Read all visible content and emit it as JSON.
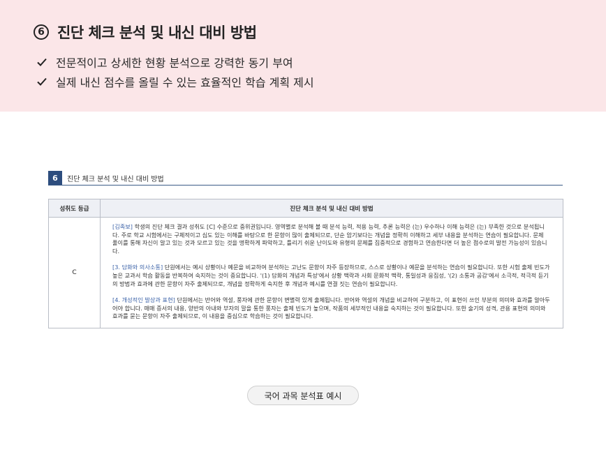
{
  "header": {
    "number": "6",
    "title": "진단 체크 분석 및 내신 대비 방법",
    "bullets": [
      "전문적이고 상세한 현황 분석으로 강력한 동기 부여",
      "실제 내신 점수를 올릴 수 있는 효율적인 학습 계획 제시"
    ],
    "background_color": "#fbe6e8"
  },
  "document": {
    "number": "6",
    "title": "진단 체크 분석 및 내신 대비 방법",
    "accent_color": "#2d4d7e",
    "table": {
      "columns": [
        "성취도 등급",
        "진단 체크 분석 및 내신 대비 방법"
      ],
      "rows": [
        {
          "grade": "C",
          "paragraphs": [
            {
              "tag": "[김족보]",
              "text": " 학생의 진단 체크 결과 성취도 [C] 수준으로 중위권입니다. 영역별로 분석해 볼 때 분석 능력, 적용 능력, 추론 능력은 (는) 우수하나 이해 능력은 (는) 부족한 것으로 분석됩니다. 주로 학교 시험에서는 구체적이고 심도 있는 이해를 바탕으로 한 문항이 많이 출제되므로, 단순 암기보다는 개념을 정확히 이해하고 세부 내용을 분석하는 연습이 필요합니다. 문제 풀이를 통해 자신이 알고 있는 것과 모르고 있는 것을 명확하게 파악하고, 틀리기 쉬운 난이도와 유형의 문제를 집중적으로 경험하고 연습한다면 더 높은 점수로의 발전 가능성이 있습니다."
            },
            {
              "tag": "[3. 담화와 의사소통]",
              "text": " 단원에서는 예시 상황이나 예문을 비교하여 분석하는 고난도 문항이 자주 등장하므로, 스스로 상황이나 예문을 분석하는 연습이 필요합니다. 또한 시험 출제 빈도가 높은 교과서 학습 활동을 반복하여 숙지하는 것이 중요합니다. '(1) 담화의 개념과 특성'에서 상황 맥락과 사회 문화적 맥락, 통일성과 응집성, '(2) 소통과 공감'에서 소극적, 적극적 듣기의 방법과 효과에 관한 문항이 자주 출제되므로, 개념을 정확하게 숙지한 후 개념과 예시를 연결 짓는 연습이 필요합니다."
            },
            {
              "tag": "[4. 개성적인 발상과 표현]",
              "text": " 단원에서는 반어와 역설, 풍자에 관한 문항이 변별력 있게 출제됩니다. 반어와 역설의 개념을 비교하여 구분하고, 이 표현이 쓰인 부분의 의미와 효과를 알아두어야 합니다. 매매 증서의 내용, 양반의 아내와 부자의 말을 통한 풍자는 출제 빈도가 높으며, 작품의 세부적인 내용을 숙지하는 것이 필요합니다. 또한 술기의 성격, 관용 표현의 의미와 효과를 묻는 문항이 자주 출제되므로, 이 내용을 중심으로 학습하는 것이 필요합니다."
            }
          ]
        }
      ]
    }
  },
  "caption": "국어 과목 분석표 예시"
}
